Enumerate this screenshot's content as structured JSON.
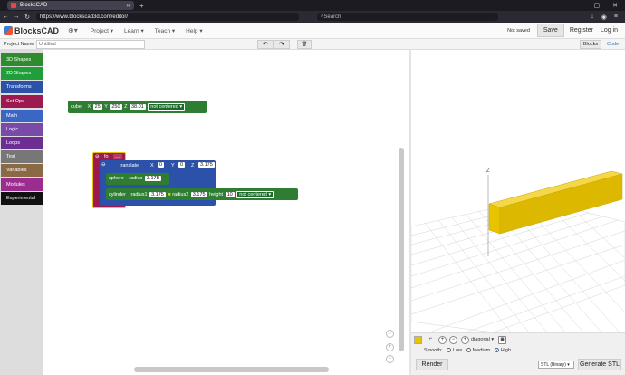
{
  "browser": {
    "tab_title": "BlocksCAD",
    "tab_close": "✕",
    "new_tab": "+",
    "url": "https://www.blockscad3d.com/editor/",
    "search_placeholder": "Search",
    "win_min": "—",
    "win_max": "▢",
    "win_close": "✕"
  },
  "app": {
    "logo_text": "BlocksCAD",
    "menus": [
      "Project ▾",
      "Learn ▾",
      "Teach ▾",
      "Help ▾"
    ],
    "status": "Not saved",
    "save_label": "Save",
    "register_label": "Register",
    "login_label": "Log in"
  },
  "project": {
    "name_label": "Project Name",
    "name_value": "Untitled",
    "tab_blocks": "Blocks",
    "tab_code": "Code"
  },
  "toolbar": {
    "undo": "↶",
    "redo": "↷",
    "trash": "🗑"
  },
  "toolbox": [
    {
      "label": "3D Shapes",
      "color": "#2e8b2e"
    },
    {
      "label": "2D Shapes",
      "color": "#1f9e3a"
    },
    {
      "label": "Transforms",
      "color": "#2b51a8"
    },
    {
      "label": "Set Ops",
      "color": "#9c1a4f"
    },
    {
      "label": "Math",
      "color": "#3b66c4"
    },
    {
      "label": "Logic",
      "color": "#7a4aa8"
    },
    {
      "label": "Loops",
      "color": "#6d2e93"
    },
    {
      "label": "Text",
      "color": "#777777"
    },
    {
      "label": "Variables",
      "color": "#8a6a45"
    },
    {
      "label": "Modules",
      "color": "#9b2d91"
    },
    {
      "label": "Experimental",
      "color": "#111111"
    }
  ],
  "blocks": {
    "cube": {
      "label": "cube",
      "x_label": "X",
      "x": "25",
      "y_label": "Y",
      "y": "250",
      "z_label": "Z",
      "z": "38.01",
      "mode": "not centered ▾"
    },
    "union": {
      "label": "fo",
      "value": "…"
    },
    "translate": {
      "label": "translate",
      "x_label": "X",
      "x": "0",
      "y_label": "Y",
      "y": "0",
      "z_label": "Z",
      "z": "3.175"
    },
    "sphere": {
      "label": "sphere",
      "r_label": "radius",
      "r": "3.175"
    },
    "cylinder": {
      "label": "cylinder",
      "r1_label": "radius1",
      "r1": "3.175",
      "r2_label": "radius2",
      "r2": "3.175",
      "h_label": "height",
      "h": "10",
      "mode": "not centered ▾"
    }
  },
  "viewer": {
    "axis_z": "Z",
    "view_select": "diagonal ▾",
    "smooth_label": "Smooth:",
    "smooth_options": [
      "Low",
      "Medium",
      "High"
    ],
    "smooth_selected": "High",
    "render_label": "Render",
    "format_select": "STL (Binary) ▾",
    "generate_label": "Generate STL",
    "colors": {
      "object": "#e8c400",
      "grid": "#cfcfcf"
    }
  },
  "zoom": {
    "plus": "+",
    "minus": "−",
    "reset": "○"
  }
}
